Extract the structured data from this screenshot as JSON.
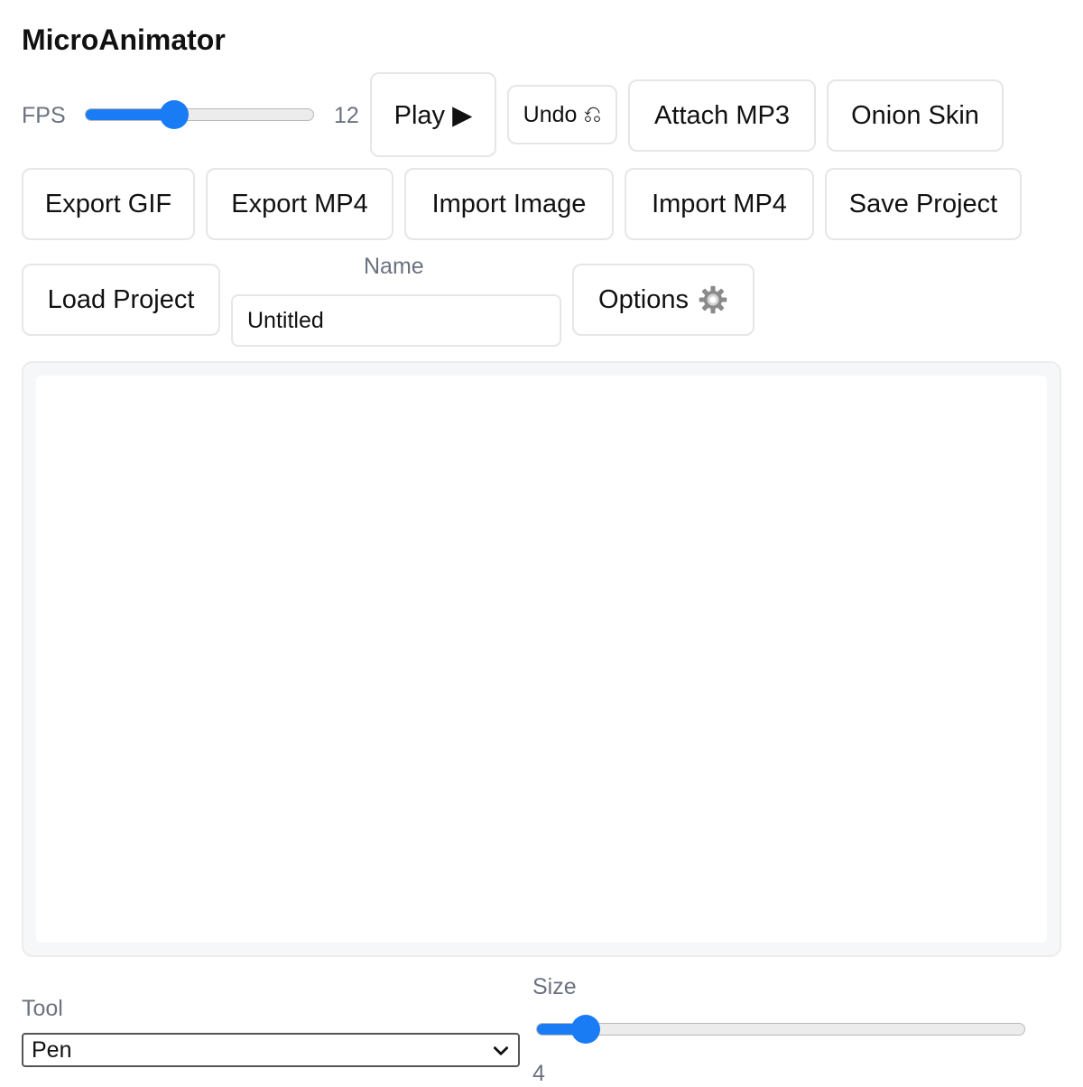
{
  "app": {
    "title": "MicroAnimator"
  },
  "fps": {
    "label": "FPS",
    "value": 12,
    "value_text": "12",
    "level_fraction": 0.39
  },
  "toolbar": {
    "play_label": "Play ▶",
    "undo_label": "Undo ⎌",
    "attach_mp3_label": "Attach MP3",
    "onion_skin_label": "Onion Skin",
    "export_gif_label": "Export GIF",
    "export_mp4_label": "Export MP4",
    "import_image_label": "Import Image",
    "import_mp4_label": "Import MP4",
    "save_project_label": "Save Project",
    "load_project_label": "Load Project",
    "options_label": "Options"
  },
  "name_field": {
    "label": "Name",
    "value": "Untitled"
  },
  "tool": {
    "label": "Tool",
    "selected": "Pen"
  },
  "size": {
    "label": "Size",
    "value": 4,
    "value_text": "4",
    "level_fraction": 0.1
  },
  "colors": {
    "accent": "#1a7cf5",
    "border": "#e6e6e6",
    "muted_text": "#6b7280"
  },
  "icons": {
    "options": "gear-icon",
    "select": "chevron-down-icon"
  }
}
